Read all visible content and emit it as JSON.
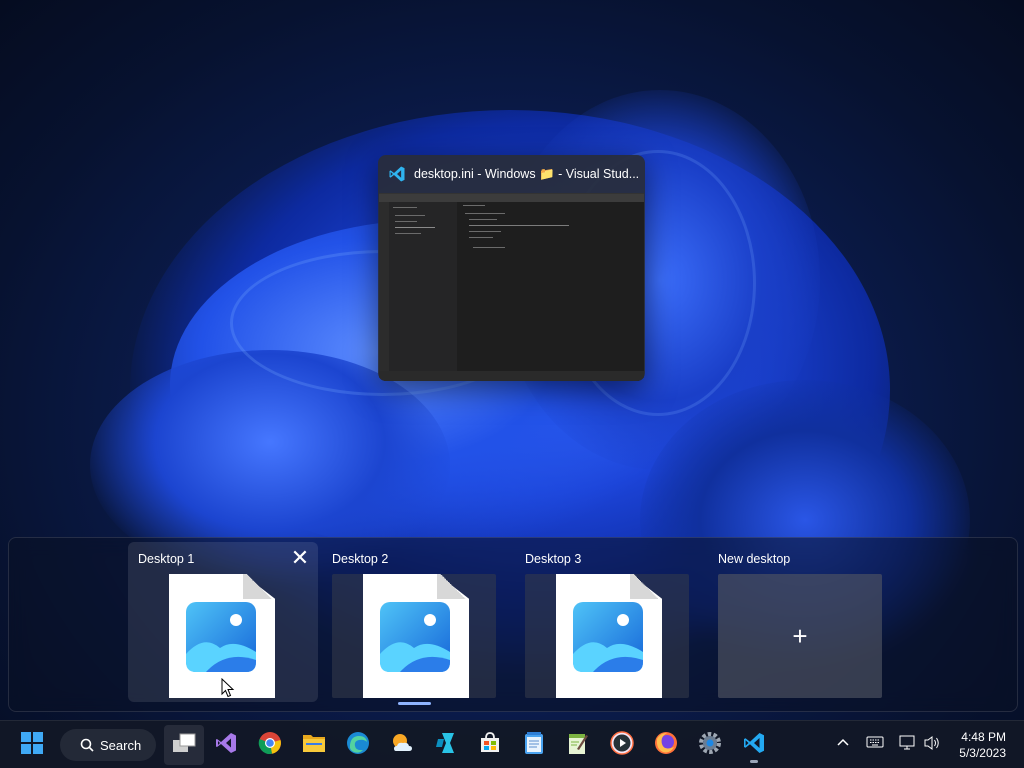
{
  "window_card": {
    "title": "desktop.ini - Windows 📁 - Visual Stud...",
    "app_icon": "vscode-icon"
  },
  "desktops": [
    {
      "label": "Desktop 1",
      "active": true,
      "thumbnail_icon": "photo-file-icon"
    },
    {
      "label": "Desktop 2",
      "active": false,
      "thumbnail_icon": "photo-file-icon"
    },
    {
      "label": "Desktop 3",
      "active": false,
      "thumbnail_icon": "photo-file-icon"
    }
  ],
  "new_desktop": {
    "label": "New desktop",
    "icon": "plus-icon"
  },
  "taskbar": {
    "search_label": "Search",
    "apps": [
      "start-icon",
      "task-view-icon",
      "visual-studio-icon",
      "chrome-icon",
      "file-explorer-icon",
      "edge-icon",
      "weather-icon",
      "dev-home-icon",
      "store-icon",
      "notepad-icon",
      "notepad-plus-icon",
      "media-player-icon",
      "firefox-icon",
      "settings-icon",
      "vscode-icon"
    ]
  },
  "tray": {
    "time": "4:48 PM",
    "date": "5/3/2023",
    "icons": [
      "chevron-up-icon",
      "keyboard-icon",
      "network-icon",
      "volume-icon"
    ]
  },
  "colors": {
    "accent": "#2f7cf6",
    "taskbar_bg": "#121826",
    "vscode_blue": "#23a9f2"
  }
}
